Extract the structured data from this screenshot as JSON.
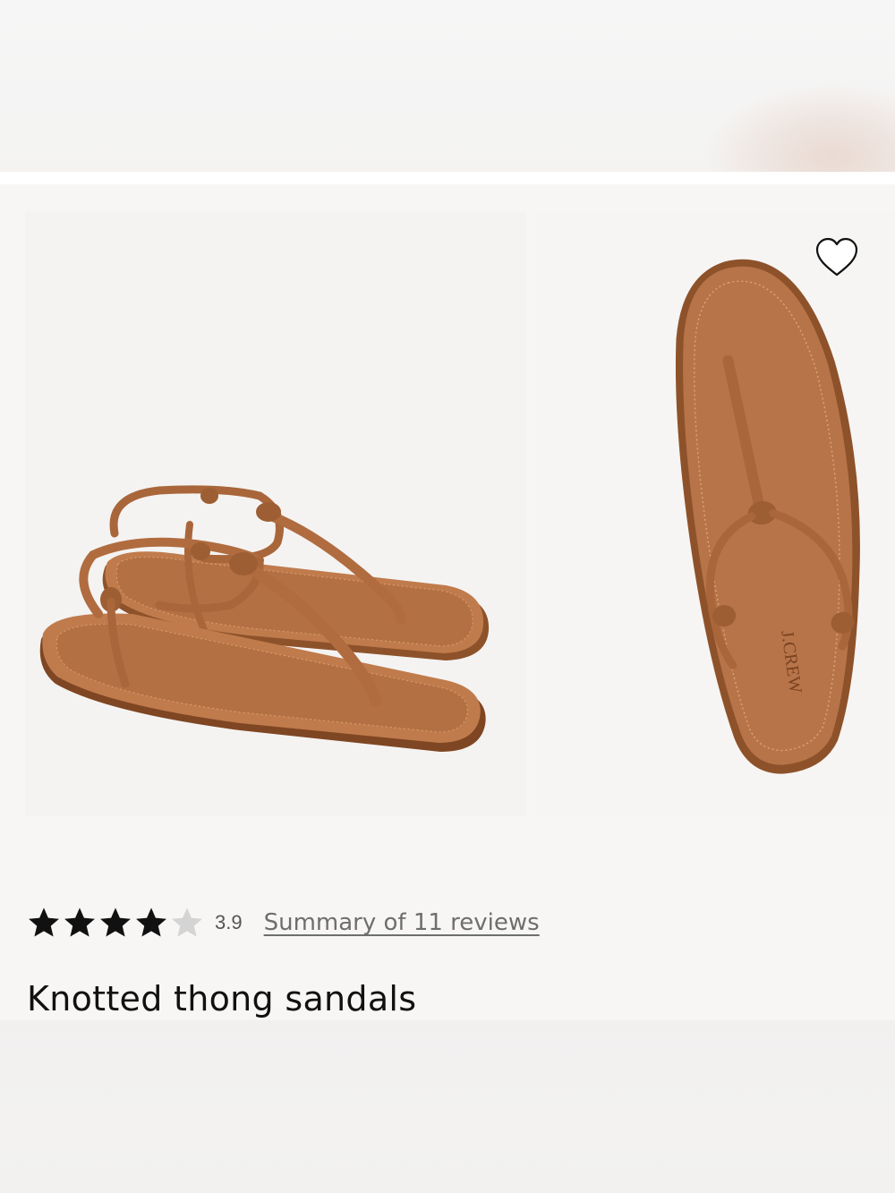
{
  "product": {
    "name": "Knotted thong sandals",
    "image_alts": [
      "Knotted thong sandals pair, three-quarter view",
      "Knotted thong sandal, top view"
    ],
    "sole_brand_text": "J.CREW",
    "colors": {
      "leather": "#b06c3f",
      "leather_dark": "#8e522b",
      "leather_light": "#c98a5b"
    }
  },
  "rating": {
    "value": "3.9",
    "filled_stars": 4,
    "total_stars": 5,
    "reviews_link_label": "Summary of 11 reviews"
  },
  "wishlist": {
    "icon": "heart-outline-icon"
  }
}
